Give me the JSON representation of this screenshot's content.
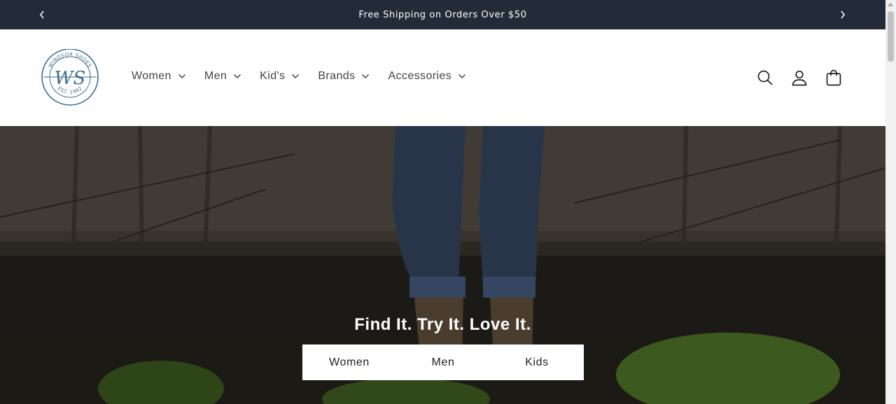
{
  "announcement": {
    "text": "Free Shipping on Orders Over $50",
    "prev_icon": "chevron-left-icon",
    "next_icon": "chevron-right-icon"
  },
  "header": {
    "logo": {
      "brand_text": "WINDSOR SHOES",
      "monogram": "WS",
      "established": "EST. 1992",
      "color": "#3d6e8f"
    },
    "nav": [
      {
        "label": "Women"
      },
      {
        "label": "Men"
      },
      {
        "label": "Kid's"
      },
      {
        "label": "Brands"
      },
      {
        "label": "Accessories"
      }
    ],
    "icons": [
      "search-icon",
      "account-icon",
      "cart-icon"
    ]
  },
  "hero": {
    "title": "Find It. Try It. Love It.",
    "buttons": [
      {
        "label": "Women"
      },
      {
        "label": "Men"
      },
      {
        "label": "Kids"
      }
    ]
  },
  "colors": {
    "announcement_bg": "#232a38",
    "text_dark": "#222222",
    "nav_text": "#444444"
  }
}
